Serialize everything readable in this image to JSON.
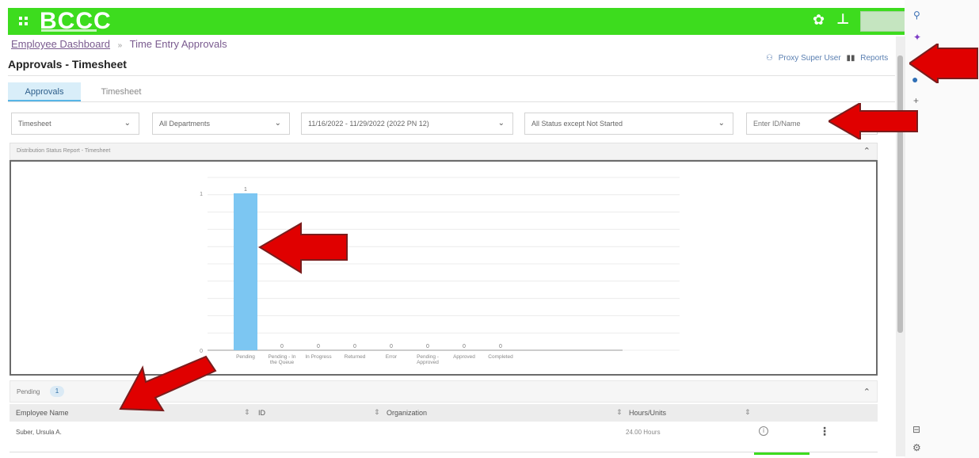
{
  "app": {
    "logo": "BCCC",
    "brand_color": "#3ddc1e",
    "icons": {
      "menu": "grid-icon",
      "settings": "gear-icon",
      "user": "user-icon"
    }
  },
  "breadcrumb": {
    "link": "Employee Dashboard",
    "separator": "»",
    "current": "Time Entry Approvals"
  },
  "page": {
    "title": "Approvals - Timesheet"
  },
  "top_links": {
    "proxy": "Proxy Super User",
    "reports": "Reports"
  },
  "tabs": [
    {
      "label": "Approvals",
      "active": true
    },
    {
      "label": "Timesheet",
      "active": false
    }
  ],
  "filters": {
    "type": "Timesheet",
    "departments": "All Departments",
    "period": "11/16/2022 - 11/29/2022 (2022 PN 12)",
    "status": "All Status except Not Started",
    "search_placeholder": "Enter ID/Name"
  },
  "report_panel": {
    "title": "Distribution Status Report - Timesheet"
  },
  "chart_data": {
    "type": "bar",
    "categories": [
      "Pending",
      "Pending - In the Queue",
      "In Progress",
      "Returned",
      "Error",
      "Pending - Approved",
      "Approved",
      "Completed"
    ],
    "values": [
      1,
      0,
      0,
      0,
      0,
      0,
      0,
      0
    ],
    "ylim": [
      0,
      1
    ],
    "yticks": [
      "0",
      "1"
    ],
    "bar_color": "#7cc6f2",
    "grid": true,
    "title": "",
    "xlabel": "",
    "ylabel": ""
  },
  "pending": {
    "label": "Pending",
    "count": "1"
  },
  "table": {
    "columns": [
      "Employee Name",
      "ID",
      "Organization",
      "Hours/Units"
    ],
    "rows": [
      {
        "name": "Suber, Ursula A.",
        "id": "",
        "organization": "",
        "hours": "24.00 Hours"
      }
    ]
  }
}
